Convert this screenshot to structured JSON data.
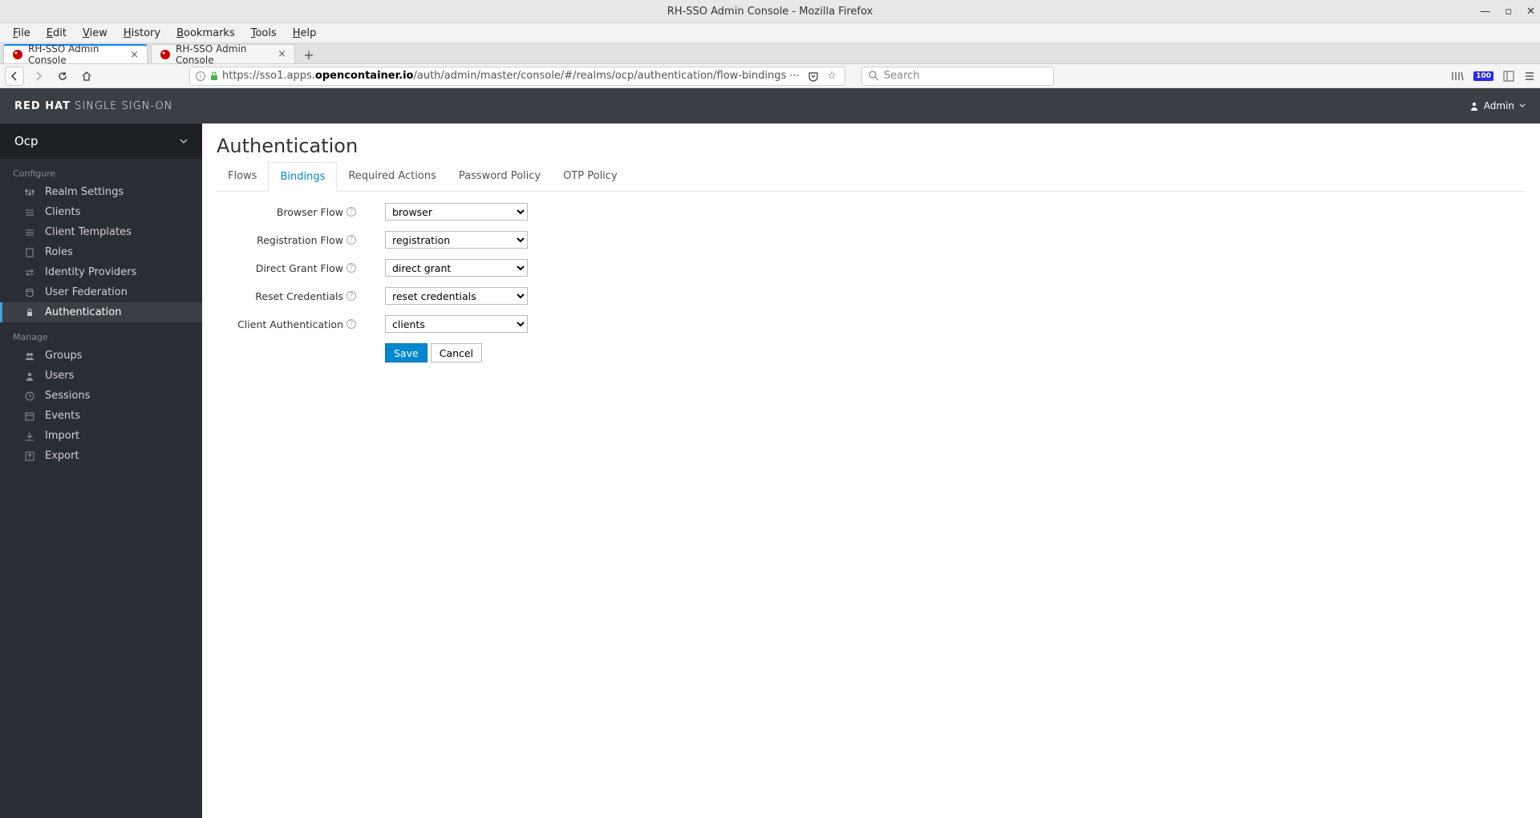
{
  "window": {
    "title": "RH-SSO Admin Console - Mozilla Firefox"
  },
  "menu": {
    "file": "File",
    "edit": "Edit",
    "view": "View",
    "history": "History",
    "bookmarks": "Bookmarks",
    "tools": "Tools",
    "help": "Help"
  },
  "tabs": [
    {
      "title": "RH-SSO Admin Console",
      "active": true
    },
    {
      "title": "RH-SSO Admin Console",
      "active": false
    }
  ],
  "url": {
    "prefix": "https://sso1.apps.",
    "host": "opencontainer.io",
    "path": "/auth/admin/master/console/#/realms/ocp/authentication/flow-bindings"
  },
  "search": {
    "placeholder": "Search"
  },
  "brand": {
    "bold": "RED HAT",
    "light": " SINGLE SIGN-ON"
  },
  "user": {
    "name": "Admin"
  },
  "realm": "Ocp",
  "sidebar": {
    "configure_label": "Configure",
    "manage_label": "Manage",
    "configure": [
      {
        "label": "Realm Settings"
      },
      {
        "label": "Clients"
      },
      {
        "label": "Client Templates"
      },
      {
        "label": "Roles"
      },
      {
        "label": "Identity Providers"
      },
      {
        "label": "User Federation"
      },
      {
        "label": "Authentication"
      }
    ],
    "manage": [
      {
        "label": "Groups"
      },
      {
        "label": "Users"
      },
      {
        "label": "Sessions"
      },
      {
        "label": "Events"
      },
      {
        "label": "Import"
      },
      {
        "label": "Export"
      }
    ]
  },
  "page": {
    "title": "Authentication"
  },
  "content_tabs": [
    {
      "label": "Flows"
    },
    {
      "label": "Bindings"
    },
    {
      "label": "Required Actions"
    },
    {
      "label": "Password Policy"
    },
    {
      "label": "OTP Policy"
    }
  ],
  "form": {
    "browser": {
      "label": "Browser Flow",
      "value": "browser"
    },
    "registration": {
      "label": "Registration Flow",
      "value": "registration"
    },
    "direct_grant": {
      "label": "Direct Grant Flow",
      "value": "direct grant"
    },
    "reset": {
      "label": "Reset Credentials",
      "value": "reset credentials"
    },
    "client_auth": {
      "label": "Client Authentication",
      "value": "clients"
    },
    "save": "Save",
    "cancel": "Cancel"
  },
  "badge": "100"
}
